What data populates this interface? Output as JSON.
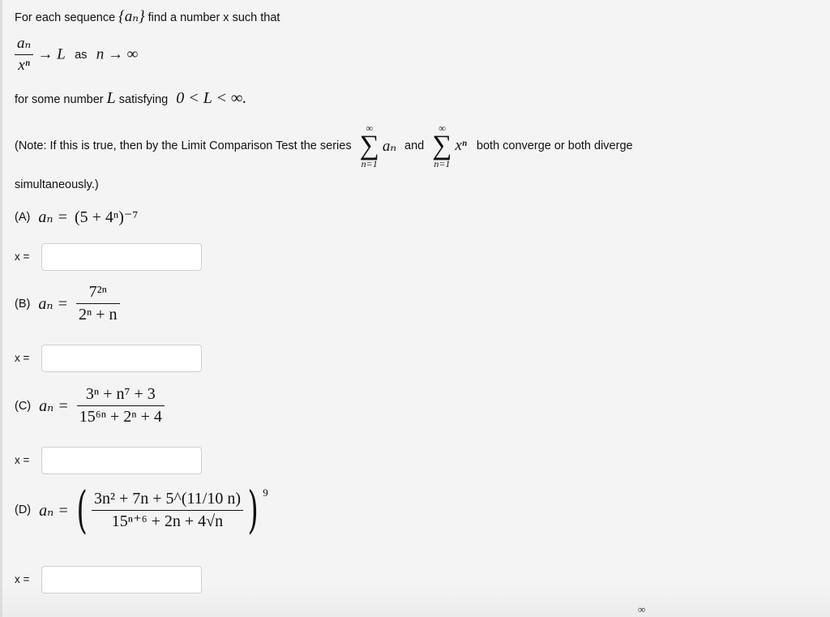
{
  "intro": {
    "line1_prefix": "For each sequence",
    "line1_seq": "{aₙ}",
    "line1_suffix": "find a number x such that",
    "limit": {
      "numerator": "aₙ",
      "denominator": "xⁿ",
      "arrow_L": "→ L",
      "as": "as",
      "n_to_inf": "n → ∞"
    },
    "line3_prefix": "for some number",
    "line3_L": "L",
    "line3_mid": "satisfying",
    "line3_ineq": "0 < L < ∞."
  },
  "note": {
    "prefix": "(Note: If this is true, then by the Limit Comparison Test the series",
    "sum1_term": "aₙ",
    "and": "and",
    "sum2_term": "xⁿ",
    "suffix": "both converge or both diverge",
    "line2": "simultaneously.)",
    "sum_upper": "∞",
    "sum_lower": "n=1",
    "sum_symbol": "∑"
  },
  "problems": [
    {
      "label": "(A)",
      "lhs": "aₙ =",
      "formula": "(5 + 4ⁿ)⁻⁷",
      "x_label": "x =",
      "answer": ""
    },
    {
      "label": "(B)",
      "lhs": "aₙ =",
      "numerator": "7²ⁿ",
      "denominator": "2ⁿ + n",
      "x_label": "x =",
      "answer": ""
    },
    {
      "label": "(C)",
      "lhs": "aₙ =",
      "numerator": "3ⁿ + n⁷ + 3",
      "denominator": "15⁶ⁿ + 2ⁿ + 4",
      "x_label": "x =",
      "answer": ""
    },
    {
      "label": "(D)",
      "lhs": "aₙ =",
      "numerator": "3n² + 7n + 5^(11/10 n)",
      "denominator": "15ⁿ⁺⁶ + 2n + 4√n",
      "exponent": "9",
      "x_label": "x =",
      "answer": ""
    }
  ],
  "footer": {
    "symbol": "∞"
  }
}
